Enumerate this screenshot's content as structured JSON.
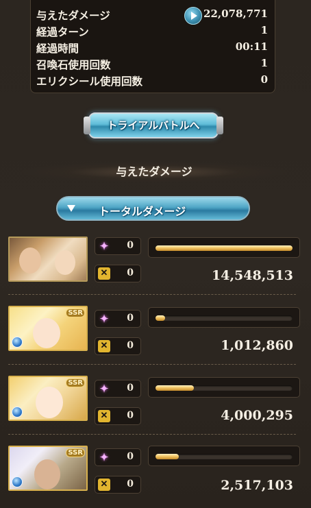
{
  "stats": {
    "rows": [
      {
        "label": "与えたダメージ",
        "value": "22,078,771"
      },
      {
        "label": "経過ターン",
        "value": "1"
      },
      {
        "label": "経過時間",
        "value": "00:11"
      },
      {
        "label": "召喚石使用回数",
        "value": "1"
      },
      {
        "label": "エリクシール使用回数",
        "value": "0"
      }
    ],
    "play_icon": "play-circle-icon"
  },
  "trial_button": {
    "label": "トライアルバトルへ"
  },
  "section_title": "与えたダメージ",
  "dropdown": {
    "label": "トータルダメージ",
    "icon": "triangle-down-icon"
  },
  "characters": [
    {
      "ssr": false,
      "element": null,
      "star_count": "0",
      "cross_count": "0",
      "damage": "14,548,513",
      "bar_fraction": 1.0
    },
    {
      "ssr": true,
      "ssr_label": "SSR",
      "element": "water",
      "star_count": "0",
      "cross_count": "0",
      "damage": "1,012,860",
      "bar_fraction": 0.07
    },
    {
      "ssr": true,
      "ssr_label": "SSR",
      "element": "water",
      "star_count": "0",
      "cross_count": "0",
      "damage": "4,000,295",
      "bar_fraction": 0.28
    },
    {
      "ssr": true,
      "ssr_label": "SSR",
      "element": "water",
      "star_count": "0",
      "cross_count": "0",
      "damage": "2,517,103",
      "bar_fraction": 0.17
    }
  ],
  "icons": {
    "star": "pink-sparkle-icon",
    "cross": "crossed-swords-icon"
  },
  "colors": {
    "bar_fill": "#f3c766",
    "button_blue": "#5fbcd8",
    "background": "#2c2620"
  }
}
